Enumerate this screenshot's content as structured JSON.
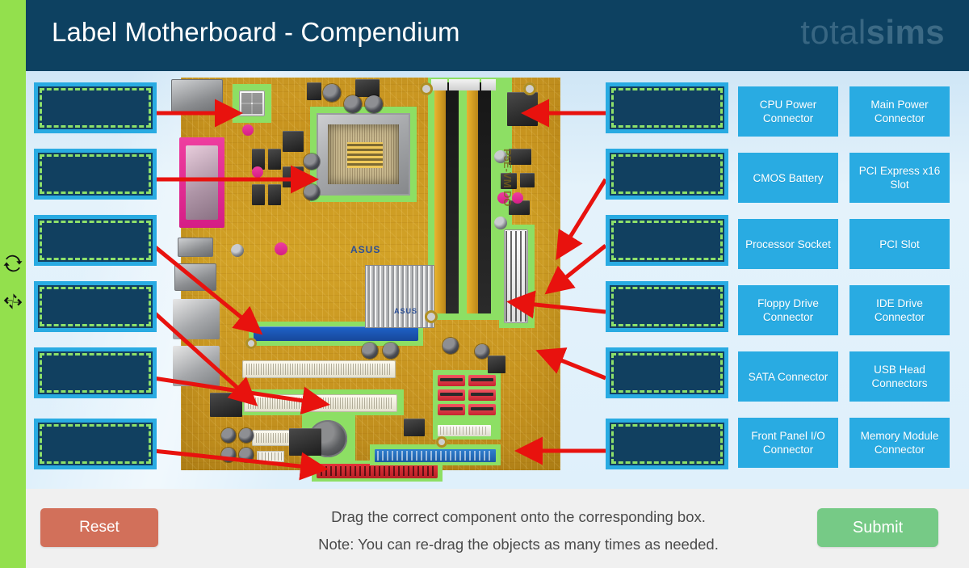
{
  "header": {
    "title": "Label Motherboard - Compendium",
    "logo_light": "total",
    "logo_bold": "sims"
  },
  "rail": {
    "refresh_icon": "refresh-icon",
    "shrink_icon": "shrink-icon"
  },
  "board": {
    "brand": "ASUS",
    "model": "P5E-VM DO",
    "heatsink_brand": "ASUS"
  },
  "dropzones": {
    "left": [
      {
        "id": "dz-l1",
        "label": ""
      },
      {
        "id": "dz-l2",
        "label": ""
      },
      {
        "id": "dz-l3",
        "label": ""
      },
      {
        "id": "dz-l4",
        "label": ""
      },
      {
        "id": "dz-l5",
        "label": ""
      },
      {
        "id": "dz-l6",
        "label": ""
      }
    ],
    "right": [
      {
        "id": "dz-r1",
        "label": ""
      },
      {
        "id": "dz-r2",
        "label": ""
      },
      {
        "id": "dz-r3",
        "label": ""
      },
      {
        "id": "dz-r4",
        "label": ""
      },
      {
        "id": "dz-r5",
        "label": ""
      },
      {
        "id": "dz-r6",
        "label": ""
      }
    ]
  },
  "labels": {
    "column_a": [
      "CPU Power Connector",
      "CMOS Battery",
      "Processor Socket",
      "Floppy Drive Connector",
      "SATA Connector",
      "Front Panel I/O Connector"
    ],
    "column_b": [
      "Main Power Connector",
      "PCI Express x16 Slot",
      "PCI Slot",
      "IDE Drive Connector",
      "USB Head Connectors",
      "Memory Module Connector"
    ]
  },
  "footer": {
    "reset_label": "Reset",
    "submit_label": "Submit",
    "instruction_line1": "Drag the correct component onto the corresponding box.",
    "instruction_line2": "Note: You can re-drag the objects as many times as needed."
  },
  "colors": {
    "rail_green": "#93e04d",
    "header_navy": "#0d4161",
    "stage_blue": "#ddf0fb",
    "accent_cyan": "#29abe2",
    "dropzone_fill": "#114060",
    "dash_green": "#8de06a",
    "arrow_red": "#e8120e",
    "highlight_green": "#8ddf64",
    "reset_salmon": "#d2705a",
    "submit_green": "#76ca86",
    "footer_gray": "#f0f0f0"
  }
}
